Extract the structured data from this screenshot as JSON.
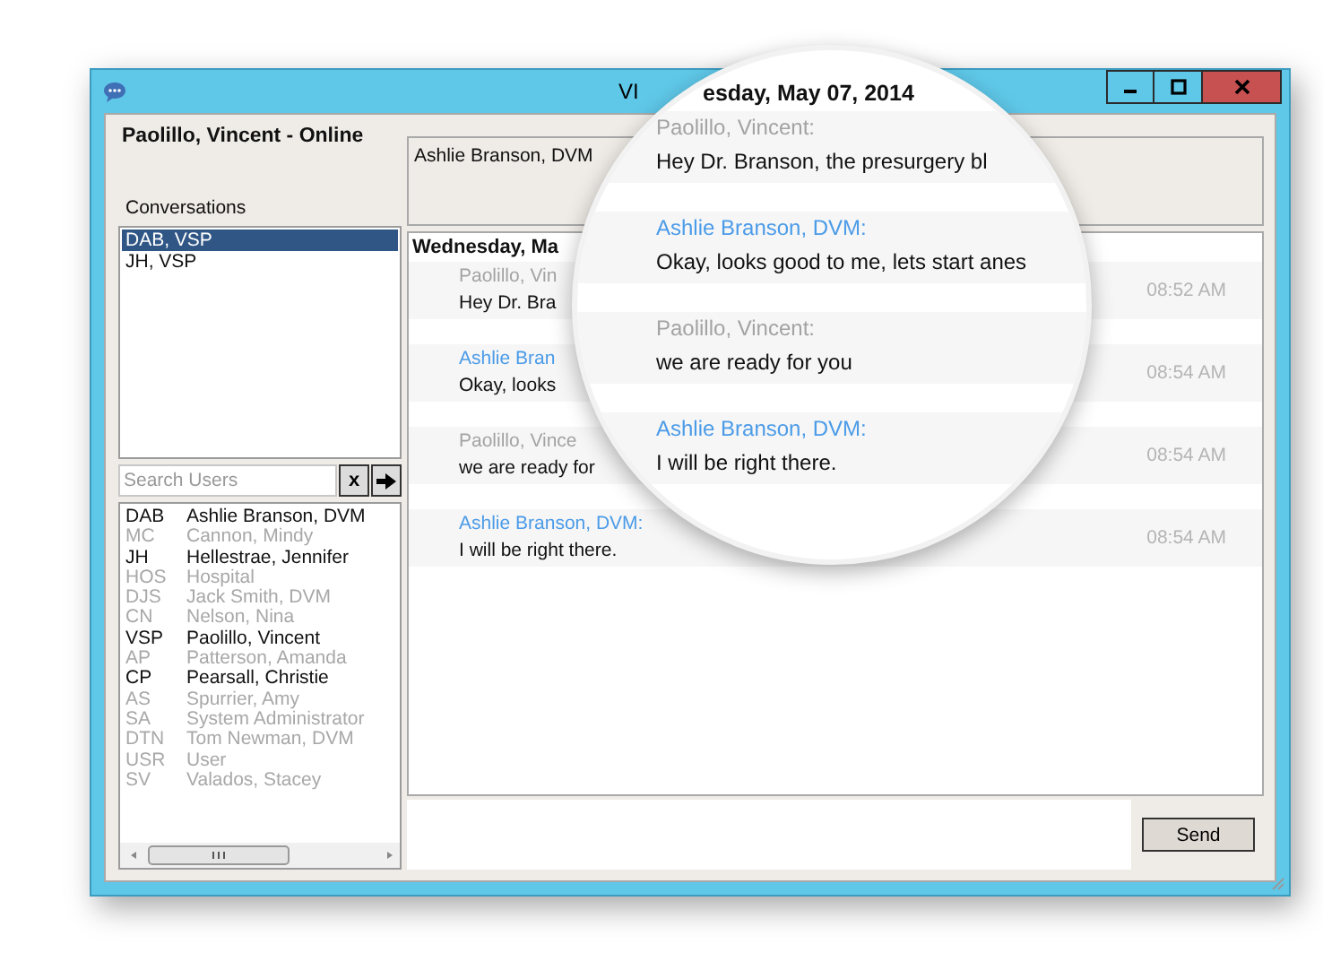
{
  "window": {
    "title": "VI"
  },
  "user_panel": {
    "status": "Paolillo, Vincent - Online",
    "conversations_label": "Conversations",
    "conversations": [
      {
        "label": "DAB, VSP",
        "selected": true
      },
      {
        "label": "JH, VSP",
        "selected": false
      }
    ],
    "search": {
      "placeholder": "Search Users",
      "clear_button": "x"
    },
    "users": [
      {
        "code": "DAB",
        "name": "Ashlie Branson, DVM",
        "online": true
      },
      {
        "code": "MC",
        "name": "Cannon, Mindy",
        "online": false
      },
      {
        "code": "JH",
        "name": "Hellestrae, Jennifer",
        "online": true
      },
      {
        "code": "HOS",
        "name": "Hospital",
        "online": false
      },
      {
        "code": "DJS",
        "name": "Jack Smith, DVM",
        "online": false
      },
      {
        "code": "CN",
        "name": "Nelson, Nina",
        "online": false
      },
      {
        "code": "VSP",
        "name": "Paolillo, Vincent",
        "online": true
      },
      {
        "code": "AP",
        "name": "Patterson, Amanda",
        "online": false
      },
      {
        "code": "CP",
        "name": "Pearsall, Christie",
        "online": true
      },
      {
        "code": "AS",
        "name": "Spurrier, Amy",
        "online": false
      },
      {
        "code": "SA",
        "name": "System Administrator",
        "online": false
      },
      {
        "code": "DTN",
        "name": "Tom Newman, DVM",
        "online": false
      },
      {
        "code": "USR",
        "name": "User",
        "online": false
      },
      {
        "code": "SV",
        "name": "Valados, Stacey",
        "online": false
      }
    ]
  },
  "chat": {
    "participants": "Ashlie Branson, DVM",
    "date": "Wednesday, Ma",
    "messages": [
      {
        "sender": "Paolillo, Vin",
        "text": "Hey Dr. Bra",
        "time": "08:52 AM",
        "is_self": true
      },
      {
        "sender": "Ashlie Bran",
        "text": "Okay, looks",
        "time": "08:54 AM",
        "is_self": false
      },
      {
        "sender": "Paolillo, Vince",
        "text": "we are ready for",
        "time": "08:54 AM",
        "is_self": true
      },
      {
        "sender": "Ashlie Branson, DVM:",
        "text": "I will be right there.",
        "time": "08:54 AM",
        "is_self": false
      }
    ],
    "send_button": "Send"
  },
  "magnifier": {
    "date": "esday, May 07, 2014",
    "messages": [
      {
        "sender": "Paolillo, Vincent:",
        "text": "Hey Dr. Branson, the presurgery bl",
        "is_self": true
      },
      {
        "sender": "Ashlie Branson, DVM:",
        "text": "Okay, looks good to me, lets start anes",
        "is_self": false
      },
      {
        "sender": "Paolillo, Vincent:",
        "text": "we are ready for you",
        "is_self": true
      },
      {
        "sender": "Ashlie Branson, DVM:",
        "text": "I will be right there.",
        "is_self": false
      }
    ]
  }
}
